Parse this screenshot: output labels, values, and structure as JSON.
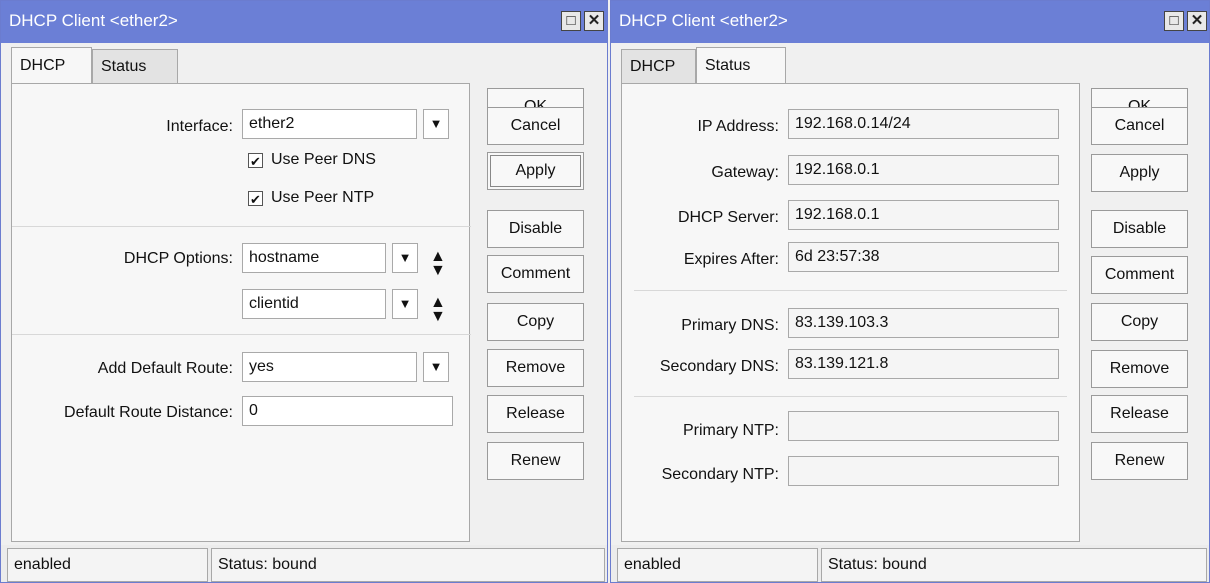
{
  "left": {
    "title": "DHCP Client <ether2>",
    "tabs": [
      "DHCP",
      "Status"
    ],
    "interface_label": "Interface:",
    "interface_value": "ether2",
    "use_peer_dns_label": "Use Peer DNS",
    "use_peer_dns_checked": true,
    "use_peer_ntp_label": "Use Peer NTP",
    "use_peer_ntp_checked": true,
    "dhcp_options_label": "DHCP Options:",
    "dhcp_options": [
      "hostname",
      "clientid"
    ],
    "add_default_route_label": "Add Default Route:",
    "add_default_route_value": "yes",
    "default_route_distance_label": "Default Route Distance:",
    "default_route_distance_value": "0",
    "status_left": "enabled",
    "status_right": "Status: bound"
  },
  "right": {
    "title": "DHCP Client <ether2>",
    "tabs": [
      "DHCP",
      "Status"
    ],
    "ip_address_label": "IP Address:",
    "ip_address_value": "192.168.0.14/24",
    "gateway_label": "Gateway:",
    "gateway_value": "192.168.0.1",
    "dhcp_server_label": "DHCP Server:",
    "dhcp_server_value": "192.168.0.1",
    "expires_after_label": "Expires After:",
    "expires_after_value": "6d 23:57:38",
    "primary_dns_label": "Primary DNS:",
    "primary_dns_value": "83.139.103.3",
    "secondary_dns_label": "Secondary DNS:",
    "secondary_dns_value": "83.139.121.8",
    "primary_ntp_label": "Primary NTP:",
    "primary_ntp_value": "",
    "secondary_ntp_label": "Secondary NTP:",
    "secondary_ntp_value": "",
    "status_left": "enabled",
    "status_right": "Status: bound"
  },
  "buttons": [
    "OK",
    "Cancel",
    "Apply",
    "Disable",
    "Comment",
    "Copy",
    "Remove",
    "Release",
    "Renew"
  ],
  "icons": {
    "maximize": "maximize-icon",
    "close": "close-icon",
    "dropdown": "dropdown-arrow-icon",
    "updown": "up-down-arrows-icon",
    "check": "checkmark-icon"
  },
  "colors": {
    "titlebar": "#6b7fd6",
    "window_bg": "#f0f0f0"
  }
}
